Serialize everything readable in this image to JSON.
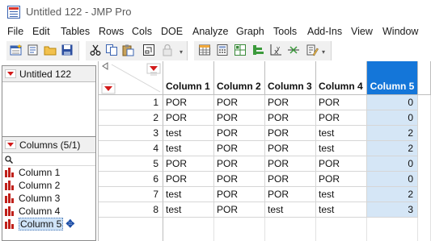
{
  "window": {
    "title": "Untitled 122 - JMP Pro"
  },
  "menu": [
    "File",
    "Edit",
    "Tables",
    "Rows",
    "Cols",
    "DOE",
    "Analyze",
    "Graph",
    "Tools",
    "Add-Ins",
    "View",
    "Window"
  ],
  "toolbar_icons": [
    "new-data-table-icon",
    "new-script-icon",
    "open-folder-icon",
    "save-icon",
    "cut-icon",
    "copy-icon",
    "paste-icon",
    "copy-as-icon",
    "lock-icon",
    "table-icon",
    "calculator-icon",
    "grid-icon",
    "distribution-icon",
    "fit-model-icon",
    "graph-builder-icon",
    "script-edit-icon"
  ],
  "left_panel": {
    "table_name": "Untitled 122",
    "columns_header": "Columns (5/1)",
    "columns": [
      "Column 1",
      "Column 2",
      "Column 3",
      "Column 4",
      "Column 5"
    ],
    "selected_column": "Column 5"
  },
  "table": {
    "headers": [
      "Column 1",
      "Column 2",
      "Column 3",
      "Column 4",
      "Column 5"
    ],
    "selected_header_index": 4,
    "rows": [
      {
        "n": "1",
        "cells": [
          "POR",
          "POR",
          "POR",
          "POR",
          "0"
        ]
      },
      {
        "n": "2",
        "cells": [
          "POR",
          "POR",
          "POR",
          "POR",
          "0"
        ]
      },
      {
        "n": "3",
        "cells": [
          "test",
          "POR",
          "POR",
          "test",
          "2"
        ]
      },
      {
        "n": "4",
        "cells": [
          "test",
          "POR",
          "POR",
          "test",
          "2"
        ]
      },
      {
        "n": "5",
        "cells": [
          "POR",
          "POR",
          "POR",
          "POR",
          "0"
        ]
      },
      {
        "n": "6",
        "cells": [
          "POR",
          "POR",
          "POR",
          "POR",
          "0"
        ]
      },
      {
        "n": "7",
        "cells": [
          "test",
          "POR",
          "POR",
          "test",
          "2"
        ]
      },
      {
        "n": "8",
        "cells": [
          "test",
          "POR",
          "test",
          "test",
          "3"
        ]
      }
    ]
  },
  "colors": {
    "selected_header": "#1476d9",
    "selected_cells": "#d5e6f6",
    "accent_red": "#d21a1a"
  }
}
